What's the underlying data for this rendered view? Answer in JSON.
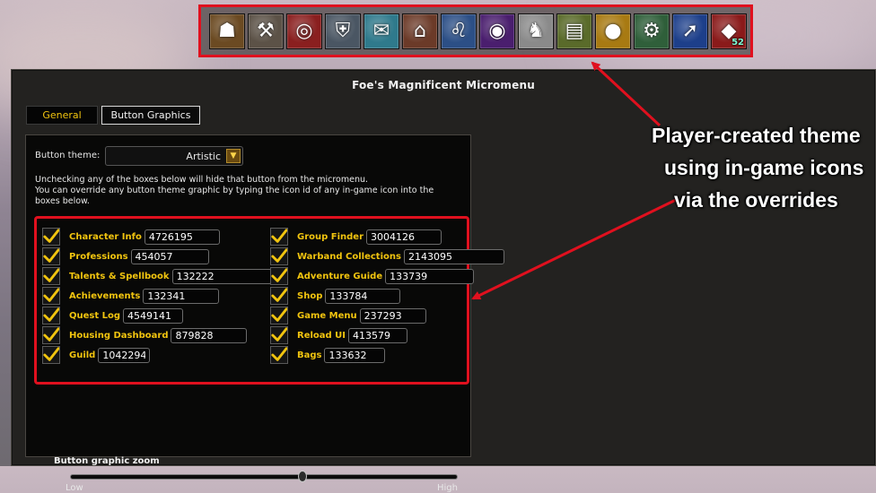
{
  "micromenu": {
    "icons": [
      {
        "name": "character-portrait-icon",
        "glyph": "☗",
        "bg": "#6b4a22"
      },
      {
        "name": "hammer-icon",
        "glyph": "⚒",
        "bg": "#5c5247"
      },
      {
        "name": "target-arrow-icon",
        "glyph": "◎",
        "bg": "#8a1f1f"
      },
      {
        "name": "shield-icon",
        "glyph": "⛨",
        "bg": "#4a5663"
      },
      {
        "name": "scroll-icon",
        "glyph": "✉",
        "bg": "#2f7a8c"
      },
      {
        "name": "treasure-map-icon",
        "glyph": "⌂",
        "bg": "#6b3a28"
      },
      {
        "name": "lion-crest-icon",
        "glyph": "♌",
        "bg": "#2c4f86"
      },
      {
        "name": "eye-icon",
        "glyph": "◉",
        "bg": "#4a1e6e"
      },
      {
        "name": "horse-head-icon",
        "glyph": "♞",
        "bg": "#8a8a8a"
      },
      {
        "name": "spellbook-icon",
        "glyph": "▤",
        "bg": "#5a6b2a"
      },
      {
        "name": "gold-coins-icon",
        "glyph": "●",
        "bg": "#a87a12"
      },
      {
        "name": "gears-icon",
        "glyph": "⚙",
        "bg": "#2f5f3a"
      },
      {
        "name": "blue-arrow-icon",
        "glyph": "➚",
        "bg": "#1d3f8a"
      },
      {
        "name": "red-bag-icon",
        "glyph": "◆",
        "bg": "#8a1a1a",
        "badge": "52"
      }
    ]
  },
  "panel": {
    "title": "Foe's Magnificent Micromenu",
    "tabs": {
      "general": "General",
      "button_graphics": "Button Graphics"
    },
    "theme_label": "Button theme:",
    "theme_value": "Artistic",
    "instructions": [
      "Unchecking any of the boxes below will hide that button from the micromenu.",
      "You can override any button theme graphic by typing the icon id of any in-game icon into the",
      "boxes below."
    ],
    "options_left": [
      {
        "label": "Character Info",
        "value": "4726195"
      },
      {
        "label": "Professions",
        "value": "454057"
      },
      {
        "label": "Talents & Spellbook",
        "value": "132222"
      },
      {
        "label": "Achievements",
        "value": "132341"
      },
      {
        "label": "Quest Log",
        "value": "4549141"
      },
      {
        "label": "Housing Dashboard",
        "value": "879828"
      },
      {
        "label": "Guild",
        "value": "1042294"
      }
    ],
    "options_right": [
      {
        "label": "Group Finder",
        "value": "3004126"
      },
      {
        "label": "Warband Collections",
        "value": "2143095"
      },
      {
        "label": "Adventure Guide",
        "value": "133739"
      },
      {
        "label": "Shop",
        "value": "133784"
      },
      {
        "label": "Game Menu",
        "value": "237293"
      },
      {
        "label": "Reload UI",
        "value": "413579"
      },
      {
        "label": "Bags",
        "value": "133632"
      }
    ],
    "zoom": {
      "label": "Button graphic zoom",
      "low": "Low",
      "high": "High",
      "level": 0.6
    }
  },
  "annotation": {
    "lines": [
      "Player-created theme",
      "using in-game icons",
      "via the overrides"
    ],
    "color": "#e0101e"
  },
  "colors": {
    "gold_text": "#f1c40f",
    "highlight_red": "#e0101e",
    "panel_bg": "#232220"
  }
}
